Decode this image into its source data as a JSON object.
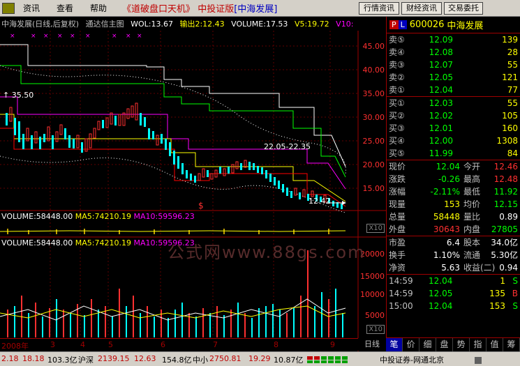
{
  "menu": {
    "items": [
      "资讯",
      "查看",
      "帮助"
    ],
    "title_quote": "《道破盘口天机》",
    "title_broker": "中投证版",
    "title_stock": "[中海发展]",
    "buttons": [
      "行情资讯",
      "财经资讯",
      "交易委托"
    ]
  },
  "chart": {
    "header": {
      "name": "中海发展(日线,后复权)",
      "indicator": "通达信主图",
      "wol": "WOL:13.67",
      "signal": "输出2:12.43",
      "volume": "VOLUME:17.53",
      "v5": "V5:19.72",
      "v10": "V10:"
    },
    "y_labels": [
      "45.00",
      "40.00",
      "35.00",
      "30.00",
      "25.00",
      "20.00",
      "15.00"
    ],
    "annotations": {
      "high": "35.50",
      "mid": "22.05-22.35",
      "low": "12.42"
    },
    "dollar": "$",
    "sub1": {
      "a": "VOLUME:58448.00",
      "b": "MA5:74210.19",
      "c": "MA10:59596.23",
      "x10": "X10"
    },
    "sub2": {
      "a": "VOLUME:58448.00",
      "b": "MA5:74210.19",
      "c": "MA10:59596.23",
      "x10": "X10"
    },
    "vol_labels": [
      "20000",
      "15000",
      "10000",
      "5000"
    ],
    "watermark": "公式网www.88gs.com",
    "x_labels": [
      "2008年",
      "3",
      "4",
      "5",
      "6",
      "7",
      "8",
      "9"
    ],
    "period": "日线"
  },
  "quote": {
    "code": "600026",
    "name": "中海发展",
    "sells": [
      {
        "label": "卖⑤",
        "price": "12.09",
        "amount": "139"
      },
      {
        "label": "卖④",
        "price": "12.08",
        "amount": "28"
      },
      {
        "label": "卖③",
        "price": "12.07",
        "amount": "55"
      },
      {
        "label": "卖②",
        "price": "12.05",
        "amount": "121"
      },
      {
        "label": "卖①",
        "price": "12.04",
        "amount": "77"
      }
    ],
    "buys": [
      {
        "label": "买①",
        "price": "12.03",
        "amount": "55"
      },
      {
        "label": "买②",
        "price": "12.02",
        "amount": "105"
      },
      {
        "label": "买③",
        "price": "12.01",
        "amount": "160"
      },
      {
        "label": "买④",
        "price": "12.00",
        "amount": "1308"
      },
      {
        "label": "买⑤",
        "price": "11.99",
        "amount": "84"
      }
    ],
    "stats": [
      {
        "l1": "现价",
        "v1": "12.04",
        "l2": "今开",
        "v2": "12.46"
      },
      {
        "l1": "涨跌",
        "v1": "-0.26",
        "l2": "最高",
        "v2": "12.48"
      },
      {
        "l1": "涨幅",
        "v1": "-2.11%",
        "l2": "最低",
        "v2": "11.92"
      },
      {
        "l1": "现量",
        "v1": "153",
        "l2": "均价",
        "v2": "12.15"
      },
      {
        "l1": "总量",
        "v1": "58448",
        "l2": "量比",
        "v2": "0.89"
      },
      {
        "l1": "外盘",
        "v1": "30643",
        "l2": "内盘",
        "v2": "27805"
      }
    ],
    "stats2": [
      {
        "l1": "市盈",
        "v1": "6.4",
        "l2": "股本",
        "v2": "34.0亿"
      },
      {
        "l1": "换手",
        "v1": "1.10%",
        "l2": "流通",
        "v2": "5.30亿"
      },
      {
        "l1": "净资",
        "v1": "5.63",
        "l2": "收益(二)",
        "v2": "0.94"
      }
    ],
    "ticks": [
      {
        "time": "14:59",
        "price": "12.04",
        "vol": "1",
        "dir": "S"
      },
      {
        "time": "14:59",
        "price": "12.05",
        "vol": "135",
        "dir": "B"
      },
      {
        "time": "15:00",
        "price": "12.04",
        "vol": "153",
        "dir": "S"
      }
    ],
    "tabs": [
      "笔",
      "价",
      "细",
      "盘",
      "势",
      "指",
      "值",
      "筹"
    ]
  },
  "status": {
    "s1a": "2.18",
    "s1b": "18.18",
    "s1c": "103.3亿",
    "s2l": "沪深",
    "s2a": "2139.15",
    "s2b": "12.63",
    "s2c": "154.8亿",
    "s3l": "中小",
    "s3a": "2750.81",
    "s3b": "19.29",
    "s3c": "10.87亿",
    "broker": "中投证券-网通北京"
  }
}
